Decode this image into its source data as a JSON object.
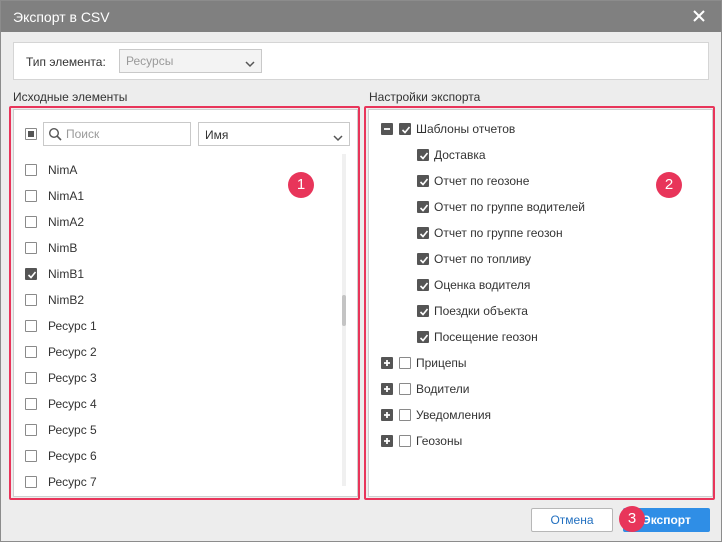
{
  "window": {
    "title": "Экспорт в CSV"
  },
  "type_bar": {
    "label": "Тип элемента:",
    "selected": "Ресурсы"
  },
  "source": {
    "label": "Исходные элементы",
    "search_placeholder": "Поиск",
    "sort_selected": "Имя",
    "items": [
      {
        "label": "NimA",
        "checked": false
      },
      {
        "label": "NimA1",
        "checked": false
      },
      {
        "label": "NimA2",
        "checked": false
      },
      {
        "label": "NimB",
        "checked": false
      },
      {
        "label": "NimB1",
        "checked": true
      },
      {
        "label": "NimB2",
        "checked": false
      },
      {
        "label": "Ресурс 1",
        "checked": false
      },
      {
        "label": "Ресурс 2",
        "checked": false
      },
      {
        "label": "Ресурс 3",
        "checked": false
      },
      {
        "label": "Ресурс 4",
        "checked": false
      },
      {
        "label": "Ресурс 5",
        "checked": false
      },
      {
        "label": "Ресурс 6",
        "checked": false
      },
      {
        "label": "Ресурс 7",
        "checked": false
      }
    ]
  },
  "settings": {
    "label": "Настройки экспорта",
    "tree": [
      {
        "label": "Шаблоны отчетов",
        "expanded": true,
        "checked": true,
        "children": [
          {
            "label": "Доставка",
            "checked": true
          },
          {
            "label": "Отчет по геозоне",
            "checked": true
          },
          {
            "label": "Отчет по группе водителей",
            "checked": true
          },
          {
            "label": "Отчет по группе геозон",
            "checked": true
          },
          {
            "label": "Отчет по топливу",
            "checked": true
          },
          {
            "label": "Оценка водителя",
            "checked": true
          },
          {
            "label": "Поездки объекта",
            "checked": true
          },
          {
            "label": "Посещение геозон",
            "checked": true
          }
        ]
      },
      {
        "label": "Прицепы",
        "expanded": false,
        "checked": false
      },
      {
        "label": "Водители",
        "expanded": false,
        "checked": false
      },
      {
        "label": "Уведомления",
        "expanded": false,
        "checked": false
      },
      {
        "label": "Геозоны",
        "expanded": false,
        "checked": false
      }
    ]
  },
  "annotations": {
    "badge1": "1",
    "badge2": "2",
    "badge3": "3"
  },
  "buttons": {
    "cancel": "Отмена",
    "export": "Экспорт"
  },
  "colors": {
    "highlight": "#e8355a",
    "primary": "#2f8ee6",
    "titlebar": "#808080"
  }
}
